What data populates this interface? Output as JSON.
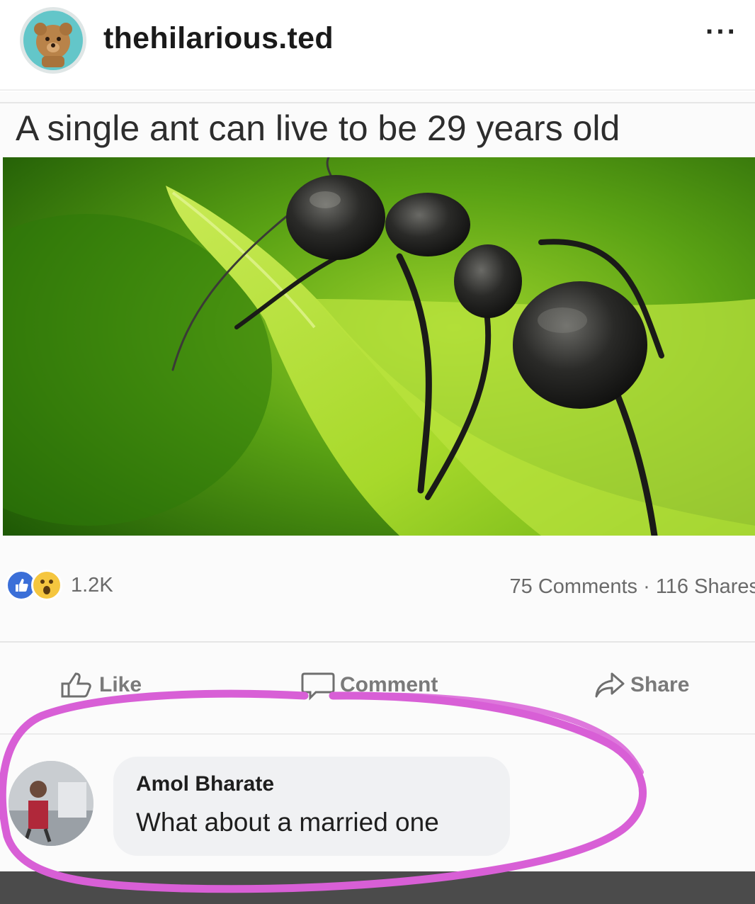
{
  "header": {
    "username": "thehilarious.ted",
    "more_label": "···",
    "avatar_icon": "teddy-bear-avatar",
    "avatar_bg": "#63c6c9"
  },
  "post": {
    "caption": "A single ant can live to be 29 years old",
    "image_subject": "ant-on-leaf-photo"
  },
  "stats": {
    "reaction_count": "1.2K",
    "comments_shares": "75 Comments · 116 Shares"
  },
  "actions": {
    "like": "Like",
    "comment": "Comment",
    "share": "Share"
  },
  "comment": {
    "author": "Amol Bharate",
    "text": "What about a married one"
  },
  "colors": {
    "highlight_ring": "#d85fd6",
    "like_blue": "#3b6fd8",
    "wow_yellow": "#f5c63f"
  }
}
